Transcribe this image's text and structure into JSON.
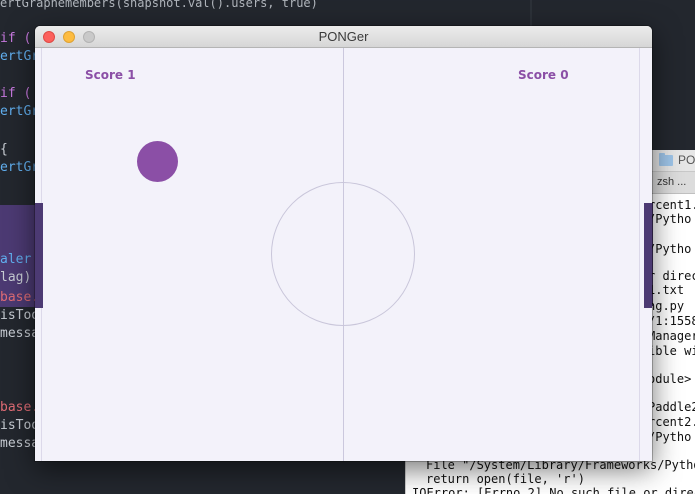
{
  "colors": {
    "accent": "#8b4fa6",
    "paddle": "#4c3a73",
    "court": "#f3f2fa",
    "center_line": "#cbc8dd"
  },
  "editor": {
    "top_line": "ertGraphemembers(snapshot.val().users, true)",
    "lines": [
      {
        "text": "if (",
        "color": "#c678dd"
      },
      {
        "text": "ertGr",
        "color": "#61afef"
      },
      {
        "text": "if (",
        "color": "#c678dd"
      },
      {
        "text": "ertGr",
        "color": "#61afef"
      },
      {
        "text": "{",
        "color": "#c8cdd4"
      },
      {
        "text": "ertGr",
        "color": "#61afef"
      },
      {
        "text": "aler",
        "color": "#61afef"
      },
      {
        "text": "lag)",
        "color": "#c8cdd4"
      },
      {
        "text": "base.",
        "color": "#e06c75"
      },
      {
        "text": "isToo",
        "color": "#c8cdd4"
      },
      {
        "text": "messa",
        "color": "#c8cdd4"
      },
      {
        "text": "base.",
        "color": "#e06c75"
      },
      {
        "text": "isToo",
        "color": "#c8cdd4"
      },
      {
        "text": "messa",
        "color": "#c8cdd4"
      }
    ]
  },
  "terminal": {
    "title": "PO",
    "tab_label": "zsh ...",
    "lines": [
      "rcent1.",
      "/Pytho",
      "/Pytho",
      "r direc",
      "1.txt",
      "ng.py",
      "/1:1558",
      "Manager",
      "ible wi",
      "odule>",
      "Paddle2",
      "rcent2.",
      "/Pytho",
      "File \"/System/Library/Frameworks/Pytho",
      "   return open(file, 'r')",
      "IOError: [Errno 2] No such file or direc"
    ]
  },
  "window": {
    "title": "PONGer"
  },
  "game": {
    "left_score_text": "Score 1",
    "right_score_text": "Score 0"
  }
}
